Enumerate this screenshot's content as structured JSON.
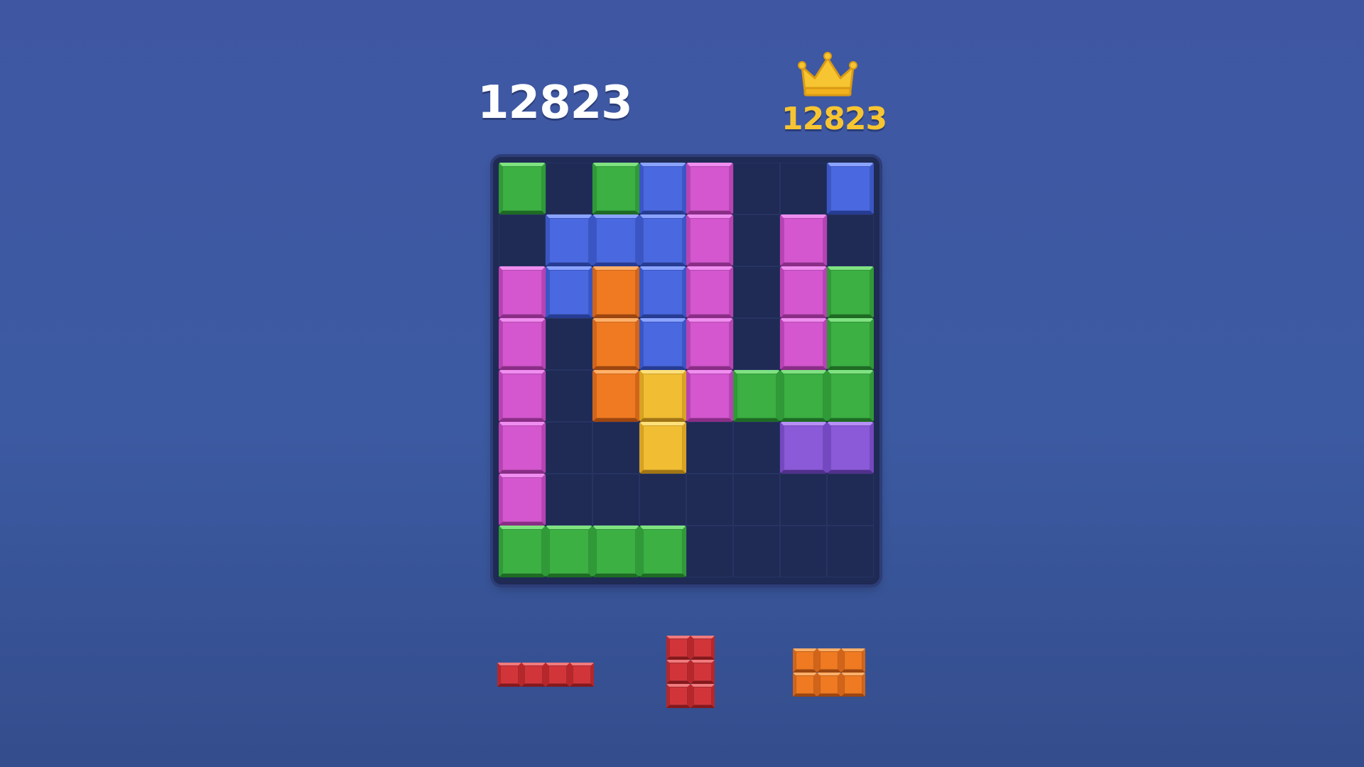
{
  "score": "12823",
  "best_score": "12823",
  "icons": {
    "best": "crown-icon"
  },
  "colors": {
    "G": {
      "c": "#3cb043",
      "hl": "#7fe281",
      "md": "#2f9a37",
      "dk": "#1e6b24"
    },
    "B": {
      "c": "#4a68e0",
      "hl": "#8aa3ff",
      "md": "#3a56c4",
      "dk": "#263c93"
    },
    "P": {
      "c": "#d457cf",
      "hl": "#f08df0",
      "md": "#b842b4",
      "dk": "#8a2d87"
    },
    "O": {
      "c": "#ef7a22",
      "hl": "#ffaf68",
      "md": "#d2641a",
      "dk": "#9c4510"
    },
    "Y": {
      "c": "#f1bd33",
      "hl": "#ffe07a",
      "md": "#d9a221",
      "dk": "#a17514"
    },
    "V": {
      "c": "#8a5ad8",
      "hl": "#b690f5",
      "md": "#7448c0",
      "dk": "#50308c"
    },
    "R": {
      "c": "#d1353a",
      "hl": "#f07a7d",
      "md": "#b6272c",
      "dk": "#84191d"
    }
  },
  "board": [
    [
      "G",
      ".",
      "G",
      "B",
      "P",
      ".",
      ".",
      "B"
    ],
    [
      ".",
      "B",
      "B",
      "B",
      "P",
      ".",
      "P",
      "."
    ],
    [
      "P",
      "B",
      "O",
      "B",
      "P",
      ".",
      "P",
      "G"
    ],
    [
      "P",
      ".",
      "O",
      "B",
      "P",
      ".",
      "P",
      "G"
    ],
    [
      "P",
      ".",
      "O",
      "Y",
      "P",
      "G",
      "G",
      "G"
    ],
    [
      "P",
      ".",
      ".",
      "Y",
      ".",
      ".",
      "V",
      "V"
    ],
    [
      "P",
      ".",
      ".",
      ".",
      ".",
      ".",
      ".",
      "."
    ],
    [
      "G",
      "G",
      "G",
      "G",
      ".",
      ".",
      ".",
      "."
    ]
  ],
  "pieces": [
    {
      "color": "R",
      "shape": [
        [
          1,
          1,
          1,
          1
        ]
      ]
    },
    {
      "color": "R",
      "shape": [
        [
          1,
          1
        ],
        [
          1,
          1
        ],
        [
          1,
          1
        ]
      ]
    },
    {
      "color": "O",
      "shape": [
        [
          1,
          1,
          1
        ],
        [
          1,
          1,
          1
        ]
      ]
    }
  ]
}
